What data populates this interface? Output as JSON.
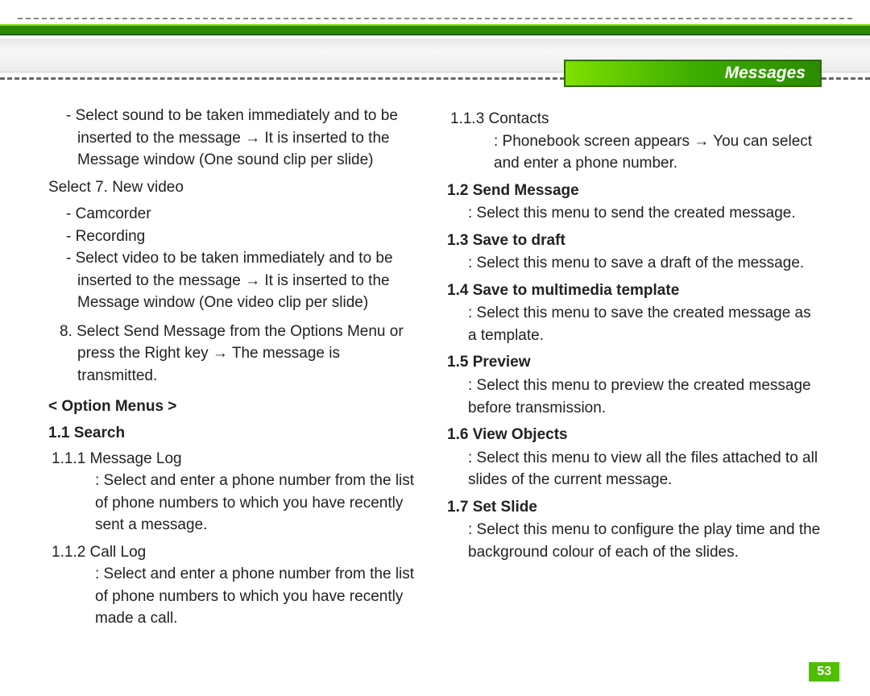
{
  "tab_title": "Messages",
  "page_number": "53",
  "left_column": {
    "p1": "- Select sound to be taken immediately and to be inserted to the message → It is inserted to the Message window (One sound clip per slide)",
    "p2": "Select 7. New video",
    "p3": "- Camcorder",
    "p4": "- Recording",
    "p5": "- Select video to be taken immediately and to be inserted to the message → It is inserted to the Message window (One video clip per slide)",
    "p6": "8. Select Send Message from the Options Menu or press the Right key → The message is transmitted.",
    "option_menus_head": "< Option Menus >",
    "s11_head": "1.1 Search",
    "s111_title": "1.1.1 Message Log",
    "s111_body": ": Select and enter a phone number from the list of phone numbers to which you have recently sent a message.",
    "s112_title": "1.1.2 Call Log",
    "s112_body": ": Select and enter a phone number from the list of phone numbers to which you have recently made a call."
  },
  "right_column": {
    "s113_title": "1.1.3 Contacts",
    "s113_body": ": Phonebook screen appears → You can select and enter a phone number.",
    "s12_head": "1.2 Send Message",
    "s12_body": ": Select this menu to send the created message.",
    "s13_head": "1.3 Save to draft",
    "s13_body": ": Select this menu to save a draft of the message.",
    "s14_head": "1.4 Save to multimedia template",
    "s14_body": ": Select this menu to save the created message as a template.",
    "s15_head": "1.5 Preview",
    "s15_body": ": Select this menu to preview the created message before transmission.",
    "s16_head": "1.6 View Objects",
    "s16_body": ": Select this menu to view all the files attached to all slides of the current message.",
    "s17_head": "1.7 Set Slide",
    "s17_body": ": Select this menu to configure the play time and the background colour of each of the slides."
  }
}
